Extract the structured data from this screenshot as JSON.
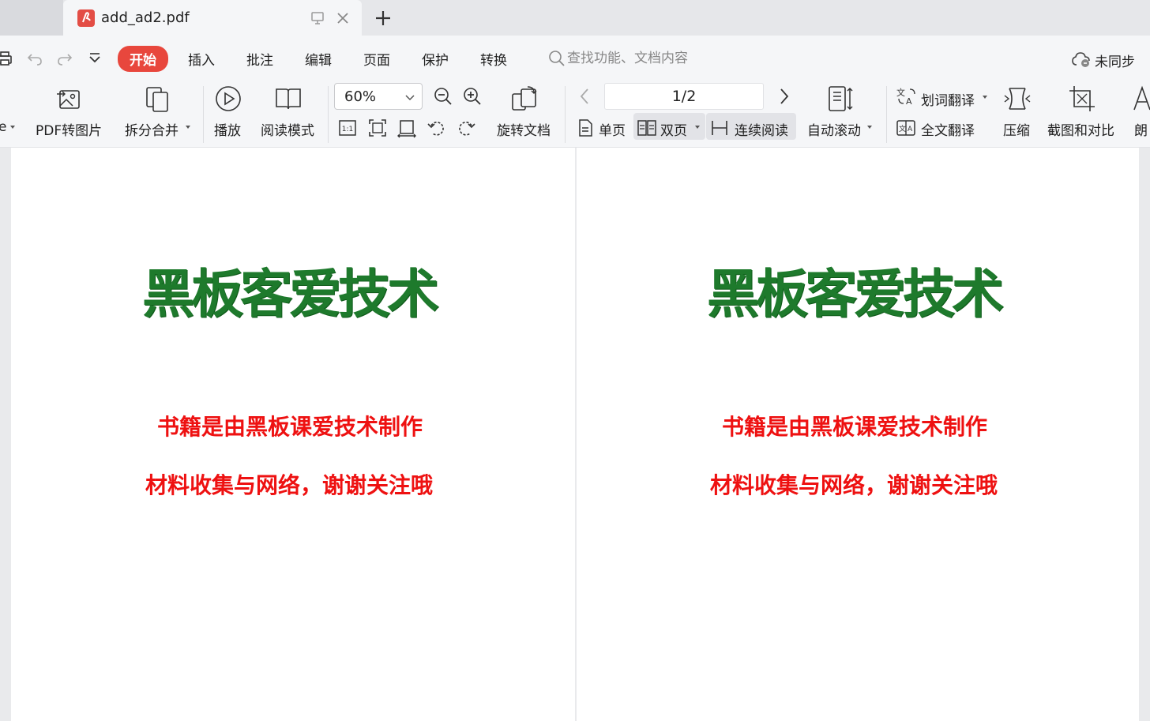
{
  "tabs": {
    "active_title": "add_ad2.pdf"
  },
  "menu": {
    "items": [
      "开始",
      "插入",
      "批注",
      "编辑",
      "页面",
      "保护",
      "转换"
    ],
    "search_placeholder": "查找功能、文档内容",
    "sync_label": "未同步"
  },
  "ribbon": {
    "cut_label": "e",
    "pdf_to_image": "PDF转图片",
    "split_merge": "拆分合并",
    "play": "播放",
    "read_mode": "阅读模式",
    "zoom": "60%",
    "rotate_doc": "旋转文档",
    "page_indicator": "1/2",
    "single_page": "单页",
    "double_page": "双页",
    "continuous": "连续阅读",
    "auto_scroll": "自动滚动",
    "word_translate": "划词翻译",
    "full_translate": "全文翻译",
    "compress": "压缩",
    "screenshot_compare": "截图和对比",
    "read_aloud": "朗"
  },
  "pages": [
    {
      "logo": "黑板客爱技术",
      "line1": "书籍是由黑板课爱技术制作",
      "line2": "材料收集与网络，谢谢关注哦"
    },
    {
      "logo": "黑板客爱技术",
      "line1": "书籍是由黑板课爱技术制作",
      "line2": "材料收集与网络，谢谢关注哦"
    }
  ],
  "colors": {
    "accent": "#e8473d",
    "logo_green": "#1e7a2c",
    "red_text": "#ee1111"
  }
}
